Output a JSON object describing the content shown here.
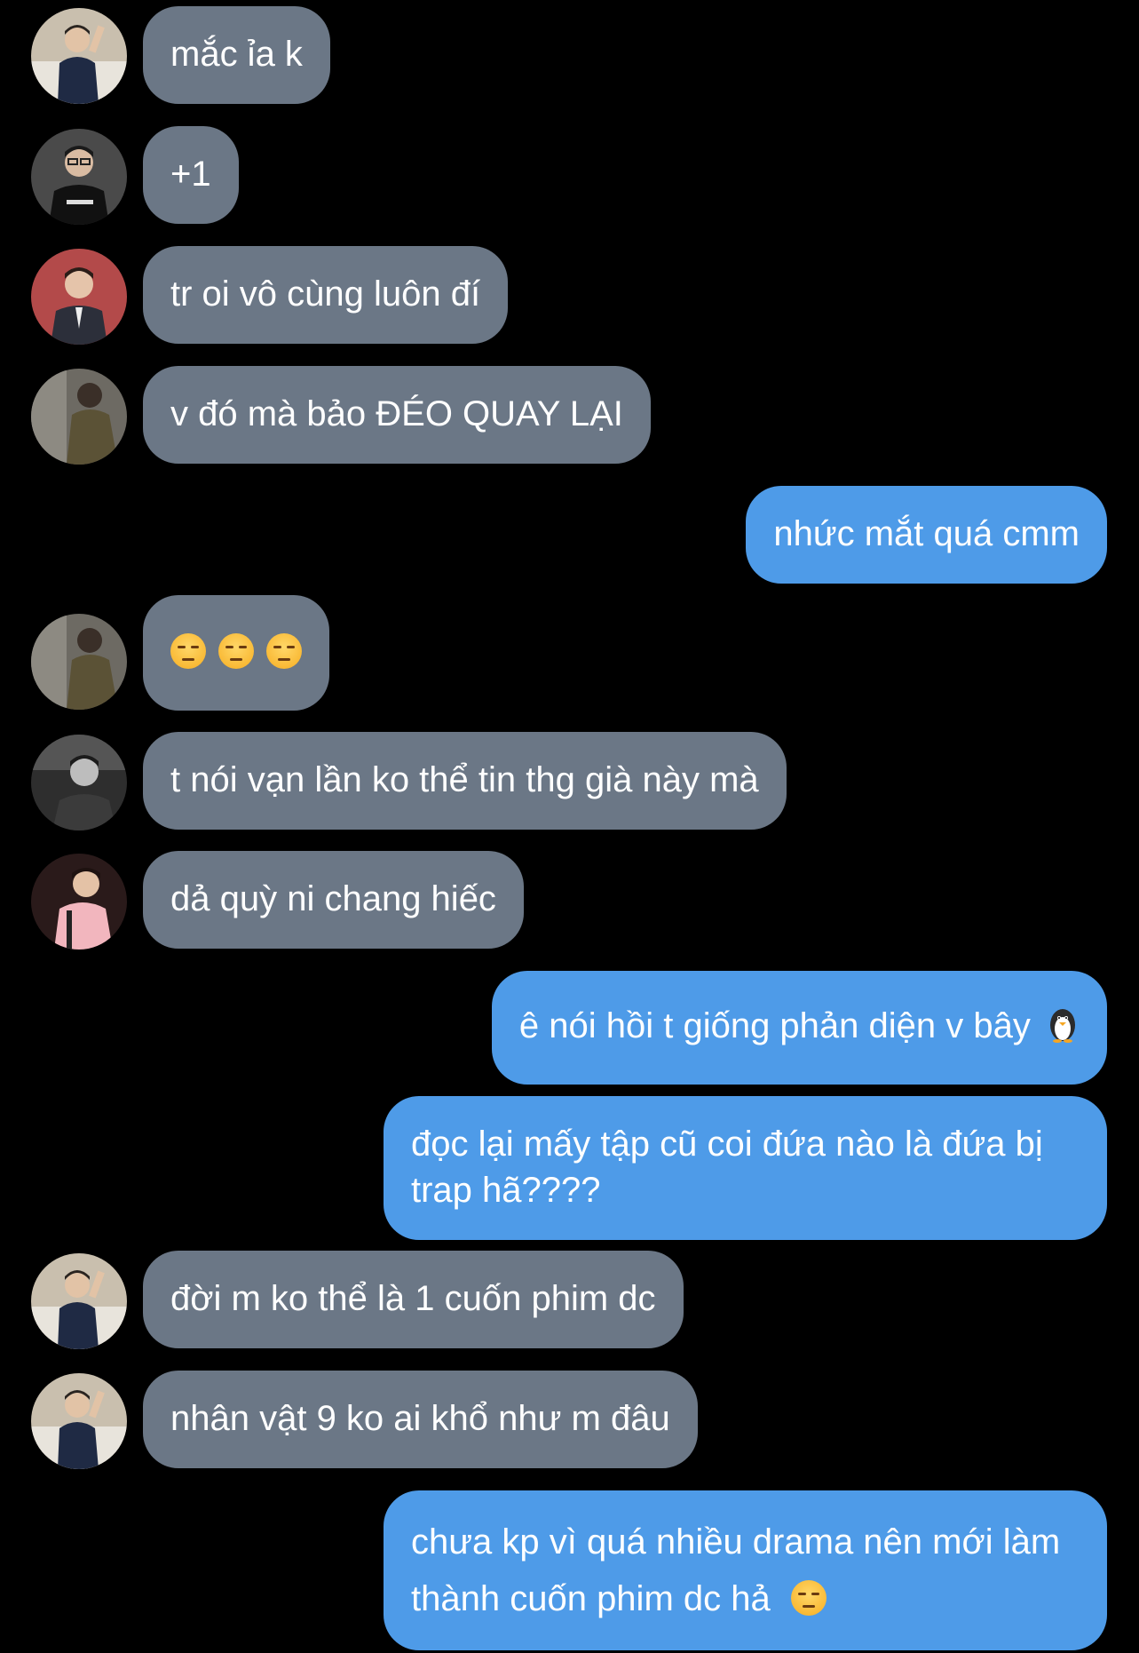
{
  "colors": {
    "background": "#000000",
    "incoming_bubble": "#6b7786",
    "outgoing_bubble": "#4e9be8",
    "text": "#ffffff"
  },
  "messages": [
    {
      "direction": "in",
      "avatar": "avatar-guy-sitting",
      "text": "mắc ỉa k"
    },
    {
      "direction": "in",
      "avatar": "avatar-guy-glasses-black-shirt",
      "text": "+1"
    },
    {
      "direction": "in",
      "avatar": "avatar-guy-suit-red-bg",
      "text": "tr oi vô cùng luôn đí"
    },
    {
      "direction": "in",
      "avatar": "avatar-guy-jacket-back",
      "text": "v đó mà bảo ĐÉO QUAY LẠI"
    },
    {
      "direction": "out",
      "text": "nhức mắt quá cmm"
    },
    {
      "direction": "in",
      "avatar": "avatar-guy-jacket-back",
      "text": "",
      "emoji": "unamused-face-emoji x3"
    },
    {
      "direction": "in",
      "avatar": "avatar-guy-monochrome",
      "text": "t nói vạn lần ko thể tin thg già này mà"
    },
    {
      "direction": "in",
      "avatar": "avatar-guy-pink-jacket",
      "text": "dả quỳ ni chang hiếc"
    },
    {
      "direction": "out",
      "text": "ê nói hồi t giống phản diện v bây",
      "emoji": "penguin-emoji"
    },
    {
      "direction": "out",
      "text": "đọc lại mấy tập cũ coi đứa nào là đứa bị trap hã????"
    },
    {
      "direction": "in",
      "avatar": "avatar-guy-sitting",
      "text": "đời m ko thể là 1 cuốn phim dc"
    },
    {
      "direction": "in",
      "avatar": "avatar-guy-sitting",
      "text": "nhân vật 9 ko ai khổ như m đâu"
    },
    {
      "direction": "out",
      "text": "chưa kp vì quá nhiều drama nên mới làm thành cuốn phim dc hả",
      "emoji": "pensive-face-emoji"
    }
  ]
}
